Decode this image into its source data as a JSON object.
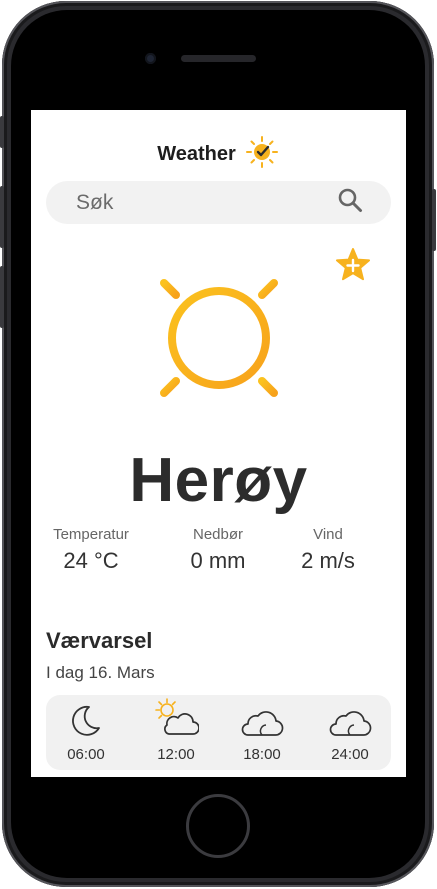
{
  "header": {
    "title": "Weather"
  },
  "search": {
    "placeholder": "Søk",
    "value": ""
  },
  "current": {
    "city": "Herøy",
    "condition_icon": "sun-icon",
    "favorite_icon": "star-plus-icon"
  },
  "stats": [
    {
      "label": "Temperatur",
      "value": "24 °C"
    },
    {
      "label": "Nedbør",
      "value": "0 mm"
    },
    {
      "label": "Vind",
      "value": "2 m/s"
    }
  ],
  "forecast": {
    "title": "Værvarsel",
    "date": "I dag 16. Mars",
    "hours": [
      {
        "time": "06:00",
        "icon": "moon-icon"
      },
      {
        "time": "12:00",
        "icon": "partly-sunny-icon"
      },
      {
        "time": "18:00",
        "icon": "cloud-icon"
      },
      {
        "time": "24:00",
        "icon": "cloud-icon"
      }
    ]
  },
  "colors": {
    "accent": "#F7B21E",
    "text": "#2C2C2C",
    "panel": "#F1F1F1"
  }
}
